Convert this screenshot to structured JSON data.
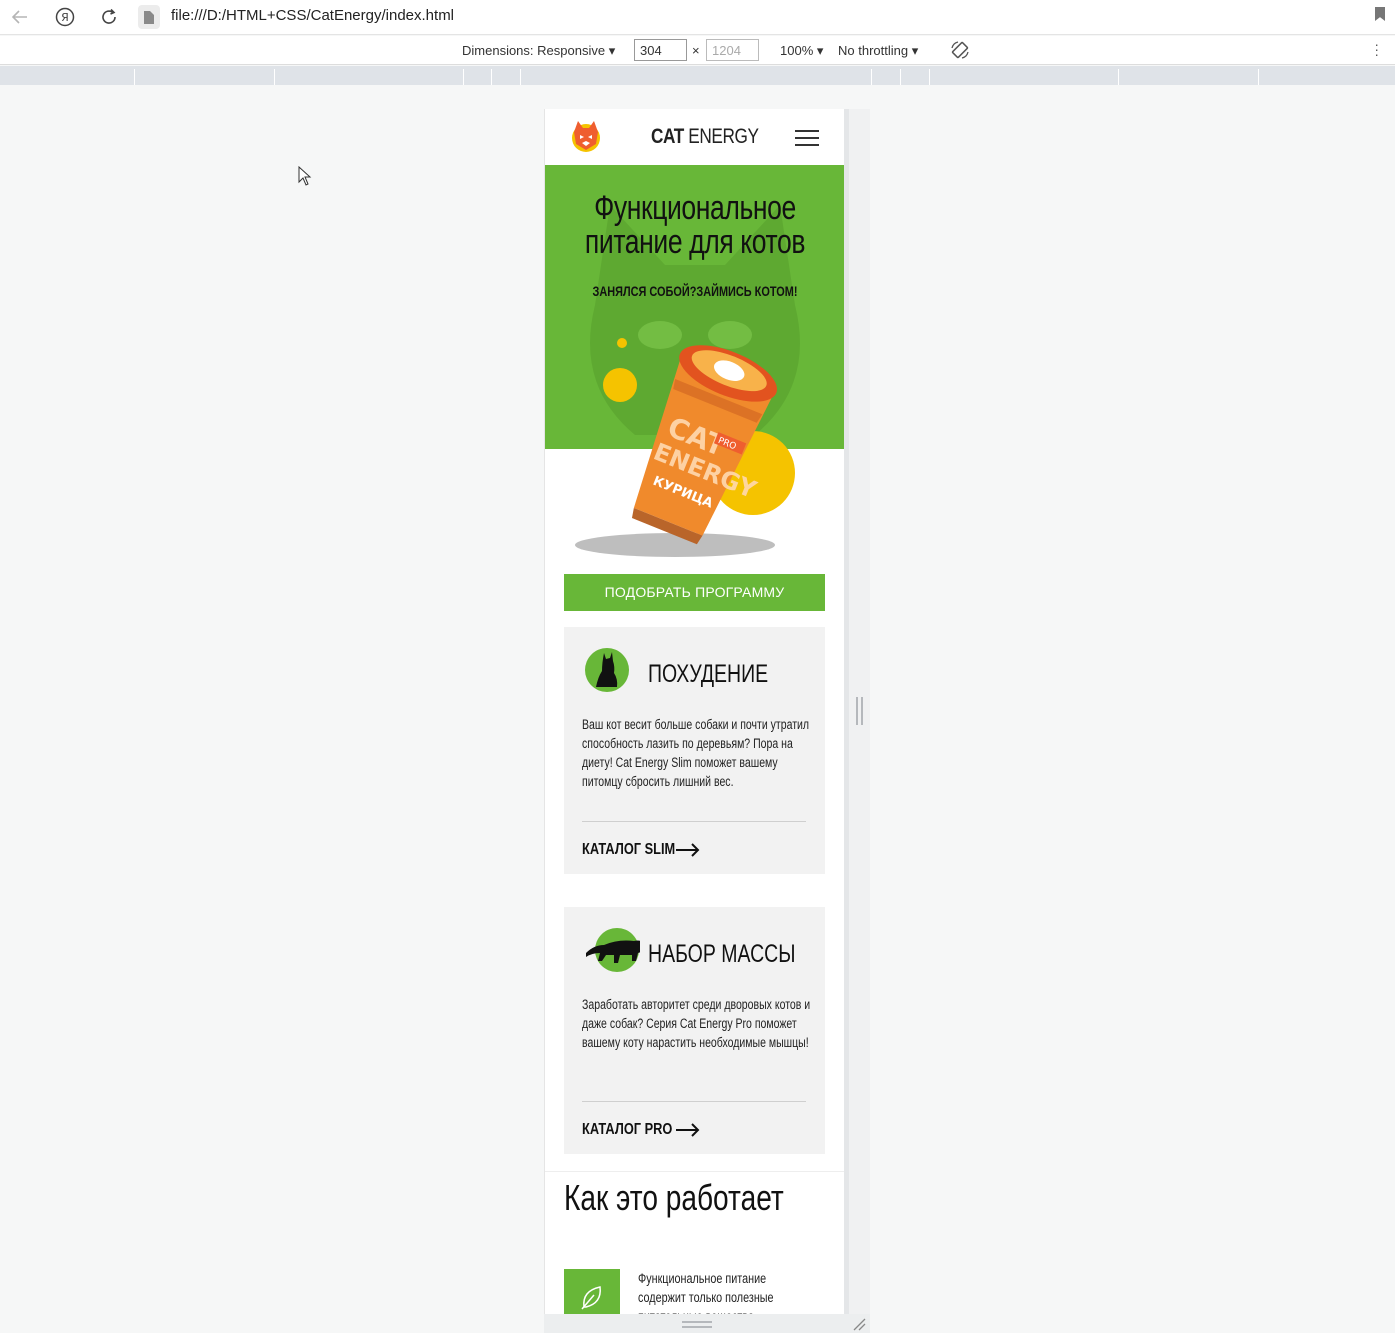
{
  "browser": {
    "url": "file:///D:/HTML+CSS/CatEnergy/index.html",
    "dimensions_label": "Dimensions: Responsive",
    "width_value": "304",
    "height_placeholder": "1204",
    "times": "×",
    "zoom": "100%",
    "throttling": "No throttling",
    "ya_glyph": "Я"
  },
  "site": {
    "brand_bold": "CAT",
    "brand_light": " ENERGY",
    "hero_title_1": "Функциональное",
    "hero_title_2": "питание для котов",
    "hero_subtitle": "ЗАНЯЛСЯ СОБОЙ?ЗАЙМИСЬ КОТОМ!",
    "cta_label": "ПОДОБРАТЬ ПРОГРАММУ",
    "cards": [
      {
        "title": "ПОХУДЕНИЕ",
        "text": "Ваш кот весит больше собаки и почти утратил способность лазить по деревьям? Пора на диету! Cat Energy Slim поможет вашему питомцу сбросить лишний вес.",
        "link": "КАТАЛОГ SLIM"
      },
      {
        "title": "НАБОР МАССЫ",
        "text": "Заработать авторитет среди дворовых котов и даже собак? Серия Cat Energy Pro поможет вашему коту нарастить необходимые мышцы!",
        "link": "КАТАЛОГ PRO"
      }
    ],
    "how_title": "Как это работает",
    "step_1_text": "Функциональное питание содержит только полезные питательные вещества."
  },
  "colors": {
    "accent_green": "#68b738",
    "card_bg": "#f2f2f2",
    "jar_orange": "#f08a2c",
    "sun_yellow": "#f5c300"
  },
  "icons": {
    "card_1": "sitting-cat-icon",
    "card_2": "panther-icon",
    "step_1": "leaf-icon"
  }
}
